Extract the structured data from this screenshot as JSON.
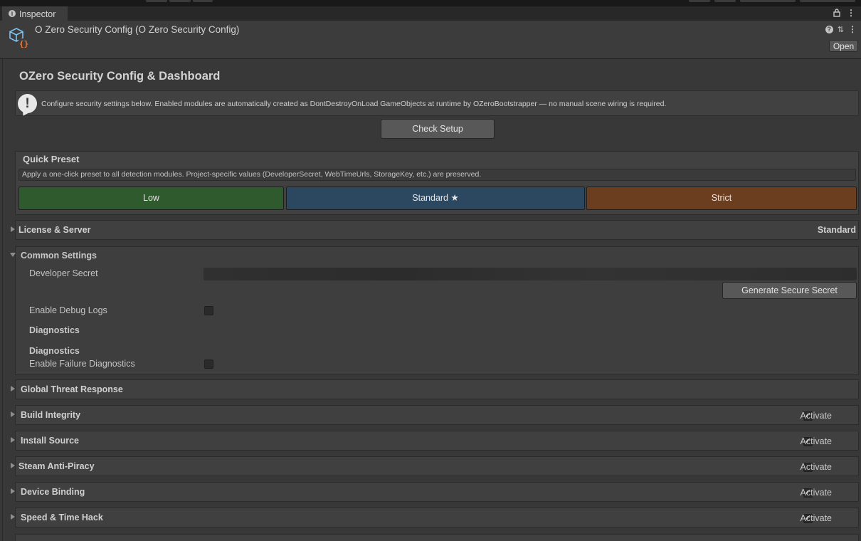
{
  "tab": {
    "label": "Inspector"
  },
  "header": {
    "title": "O Zero Security Config (O Zero Security Config)",
    "open_label": "Open"
  },
  "page": {
    "title": "OZero Security Config & Dashboard",
    "help_text": "Configure security settings below. Enabled modules are automatically created as DontDestroyOnLoad GameObjects at runtime by OZeroBootstrapper — no manual scene wiring is required.",
    "check_setup_label": "Check Setup"
  },
  "quick_preset": {
    "title": "Quick Preset",
    "description": "Apply a one-click preset to all detection modules. Project-specific values (DeveloperSecret, WebTimeUrls, StorageKey, etc.) are preserved.",
    "buttons": {
      "low": "Low",
      "standard": "Standard ★",
      "strict": "Strict"
    },
    "colors": {
      "low": "#2f5a2d",
      "standard": "#2b4860",
      "strict": "#6a3e1f"
    }
  },
  "license": {
    "label": "License & Server",
    "value": "Standard"
  },
  "common": {
    "label": "Common Settings",
    "developer_secret_label": "Developer Secret",
    "generate_label": "Generate Secure Secret",
    "debug_logs_label": "Enable Debug Logs",
    "debug_logs_checked": false,
    "diagnostics_header_1": "Diagnostics",
    "diagnostics_header_2": "Diagnostics",
    "failure_diag_label": "Enable Failure Diagnostics",
    "failure_diag_checked": false
  },
  "modules": [
    {
      "label": "Global Threat Response",
      "has_activate": false
    },
    {
      "label": "Build Integrity",
      "activate_label": "Activate",
      "checked": true
    },
    {
      "label": "Install Source",
      "activate_label": "Activate",
      "checked": true
    },
    {
      "label": "Steam Anti-Piracy",
      "activate_label": "Activate",
      "checked": false
    },
    {
      "label": "Device Binding",
      "activate_label": "Activate",
      "checked": true
    },
    {
      "label": "Speed & Time Hack",
      "activate_label": "Activate",
      "checked": true
    }
  ]
}
